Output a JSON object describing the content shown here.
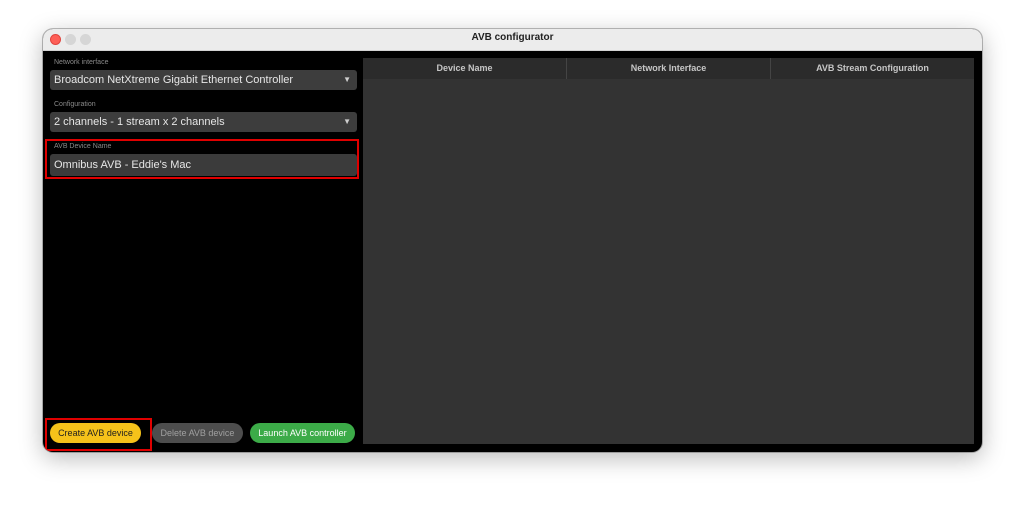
{
  "window": {
    "title": "AVB configurator"
  },
  "network_interface": {
    "label": "Network interface",
    "value": "Broadcom NetXtreme Gigabit Ethernet Controller"
  },
  "configuration": {
    "label": "Configuration",
    "value": "2 channels - 1 stream x 2 channels"
  },
  "device_name": {
    "label": "AVB Device Name",
    "value": "Omnibus AVB - Eddie's Mac"
  },
  "buttons": {
    "create": "Create AVB device",
    "delete": "Delete AVB device",
    "launch": "Launch AVB controller"
  },
  "table": {
    "columns": [
      "Device Name",
      "Network Interface",
      "AVB Stream Configuration"
    ],
    "rows": []
  },
  "colors": {
    "highlight": "#e00000",
    "create_button": "#f6c21a",
    "launch_button": "#3cab48",
    "delete_button": "#4d4d4d"
  },
  "icons": {
    "dropdown": "chevron-down-icon"
  }
}
